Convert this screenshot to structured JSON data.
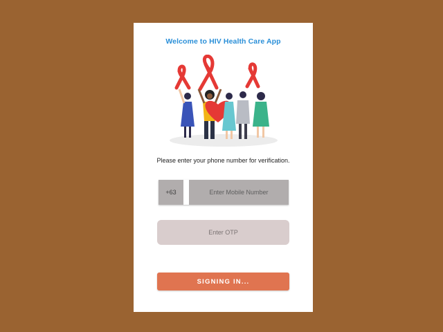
{
  "app": {
    "title": "Welcome to HIV Health Care App"
  },
  "illustration": {
    "icon": "awareness-ribbon-people-illustration",
    "ribbon_color": "#e53935"
  },
  "form": {
    "prompt": "Please enter your phone number for verification.",
    "country_code": "+63",
    "mobile_placeholder": "Enter Mobile Number",
    "otp_placeholder": "Enter OTP",
    "submit_label": "SIGNING IN..."
  },
  "colors": {
    "background": "#9a6331",
    "title": "#2a8fd8",
    "button": "#e07450",
    "phone_field": "#b1adad",
    "otp_field": "#d9cdcd"
  }
}
